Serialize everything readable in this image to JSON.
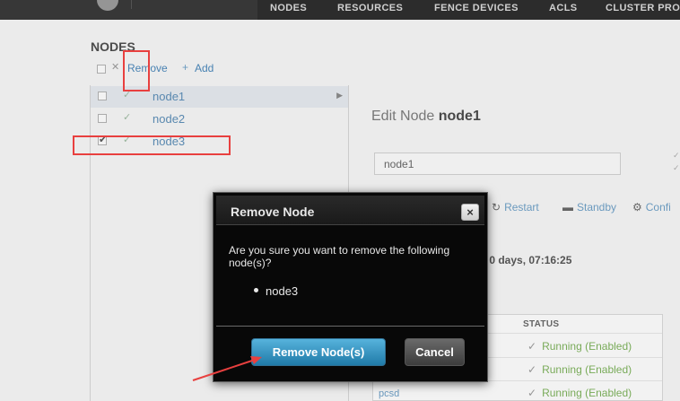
{
  "top_nav": {
    "items": [
      {
        "label": "NODES"
      },
      {
        "label": "RESOURCES"
      },
      {
        "label": "FENCE DEVICES"
      },
      {
        "label": "ACLS"
      },
      {
        "label": "CLUSTER PRO"
      }
    ]
  },
  "nodes_panel": {
    "heading": "NODES",
    "toolbar": {
      "remove_icon": "✕",
      "remove_label": "Remove",
      "add_icon": "+",
      "add_label": "Add"
    },
    "nodes": [
      {
        "name": "node1",
        "checked": false,
        "selected": true
      },
      {
        "name": "node2",
        "checked": false,
        "selected": false
      },
      {
        "name": "node3",
        "checked": true,
        "selected": false
      }
    ]
  },
  "edit_node": {
    "title_prefix": "Edit Node",
    "title_node": "node1",
    "name_field_value": "node1",
    "actions": [
      {
        "icon": "restart-icon",
        "label": "Restart"
      },
      {
        "icon": "standby-icon",
        "label": "Standby"
      },
      {
        "icon": "configure-icon",
        "label": "Confi"
      }
    ],
    "uptime": ": 0 days, 07:16:25",
    "services": {
      "status_header": "STATUS",
      "rows": [
        {
          "status": "Running (Enabled)"
        },
        {
          "status": "Running (Enabled)"
        },
        {
          "status": "Running (Enabled)"
        }
      ],
      "last_service_name": "pcsd"
    }
  },
  "dialog": {
    "title": "Remove Node",
    "close_icon": "×",
    "message": "Are you sure you want to remove the following node(s)?",
    "items": [
      "node3"
    ],
    "confirm_label": "Remove Node(s)",
    "cancel_label": "Cancel"
  },
  "annotation_color": "#e8403f"
}
